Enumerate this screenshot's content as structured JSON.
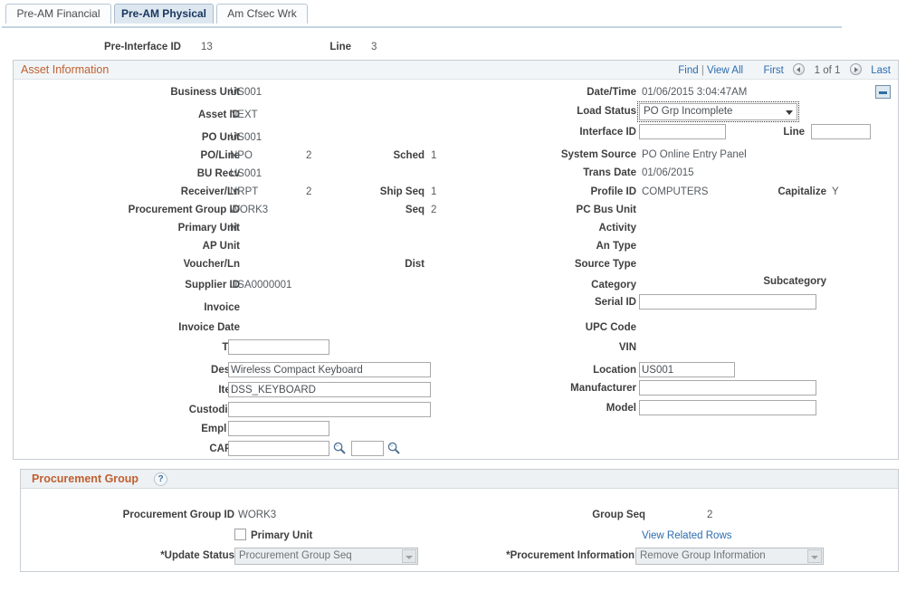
{
  "tabs": [
    {
      "label": "Pre-AM Financial",
      "active": false
    },
    {
      "label": "Pre-AM Physical",
      "active": true
    },
    {
      "label": "Am Cfsec Wrk",
      "active": false
    }
  ],
  "key_row": {
    "pre_interface_id_label": "Pre-Interface ID",
    "pre_interface_id_value": "13",
    "line_label": "Line",
    "line_value": "3"
  },
  "asset_information": {
    "title": "Asset Information",
    "nav": {
      "find": "Find",
      "separator": "|",
      "view_all": "View All",
      "first": "First",
      "counter": "1 of 1",
      "last": "Last"
    },
    "collapse_icon": "minus-icon",
    "left": {
      "business_unit_label": "Business Unit",
      "business_unit_value": "US001",
      "asset_id_label": "Asset ID",
      "asset_id_value": "NEXT",
      "po_unit_label": "PO Unit",
      "po_unit_value": "US001",
      "po_line_label": "PO/Line",
      "po_line_value": "NPO",
      "po_line_num": "2",
      "sched_label": "Sched",
      "sched_value": "1",
      "bu_recv_label": "BU Recv",
      "bu_recv_value": "US001",
      "receiver_ln_label": "Receiver/Ln",
      "receiver_ln_value": "NRPT",
      "receiver_ln_num": "2",
      "ship_seq_label": "Ship Seq",
      "ship_seq_value": "1",
      "procurement_group_id_label": "Procurement Group ID",
      "procurement_group_id_value": "WORK3",
      "seq_label": "Seq",
      "seq_value": "2",
      "primary_unit_label": "Primary Unit",
      "primary_unit_value": "N",
      "ap_unit_label": "AP Unit",
      "ap_unit_value": "",
      "voucher_ln_label": "Voucher/Ln",
      "voucher_ln_value": "",
      "dist_label": "Dist",
      "dist_value": "",
      "supplier_id_label": "Supplier ID",
      "supplier_id_value": "USA0000001",
      "invoice_label": "Invoice",
      "invoice_value": "",
      "invoice_date_label": "Invoice Date",
      "invoice_date_value": "",
      "tag_label": "Tag",
      "tag_value": "",
      "descr_label": "Descr",
      "descr_value": "Wireless Compact Keyboard",
      "item_label": "Item",
      "item_value": "DSS_KEYBOARD",
      "custodian_label": "Custodian",
      "custodian_value": "",
      "empl_id_label": "Empl ID",
      "empl_id_value": "",
      "cap_label": "CAP #",
      "cap_value": "",
      "cap_suffix_value": "",
      "cap_lookup_icon": "search-icon",
      "cap_suffix_lookup_icon": "search-icon"
    },
    "right": {
      "date_time_label": "Date/Time",
      "date_time_value": "01/06/2015 3:04:47AM",
      "load_status_label": "Load Status",
      "load_status_value": "PO Grp Incomplete",
      "load_status_options": [
        "PO Grp Incomplete"
      ],
      "interface_id_label": "Interface ID",
      "interface_id_value": "",
      "line_label": "Line",
      "line_value": "",
      "system_source_label": "System Source",
      "system_source_value": "PO Online Entry Panel",
      "trans_date_label": "Trans Date",
      "trans_date_value": "01/06/2015",
      "profile_id_label": "Profile ID",
      "profile_id_value": "COMPUTERS",
      "capitalize_label": "Capitalize",
      "capitalize_value": "Y",
      "pc_bus_unit_label": "PC Bus Unit",
      "pc_bus_unit_value": "",
      "activity_label": "Activity",
      "activity_value": "",
      "an_type_label": "An Type",
      "an_type_value": "",
      "source_type_label": "Source Type",
      "source_type_value": "",
      "category_label": "Category",
      "category_value": "",
      "subcategory_label": "Subcategory",
      "subcategory_value": "",
      "serial_id_label": "Serial ID",
      "serial_id_value": "",
      "upc_code_label": "UPC Code",
      "upc_code_value": "",
      "vin_label": "VIN",
      "vin_value": "",
      "location_label": "Location",
      "location_value": "US001",
      "manufacturer_label": "Manufacturer",
      "manufacturer_value": "",
      "model_label": "Model",
      "model_value": ""
    }
  },
  "procurement_group": {
    "title": "Procurement Group",
    "help_icon": "help-icon",
    "procurement_group_id_label": "Procurement Group ID",
    "procurement_group_id_value": "WORK3",
    "primary_unit_label": "Primary Unit",
    "primary_unit_checked": false,
    "update_status_label": "*Update Status",
    "update_status_value": "Procurement Group Seq",
    "group_seq_label": "Group Seq",
    "group_seq_value": "2",
    "view_related_rows_link": "View Related Rows",
    "procurement_information_label": "*Procurement Information",
    "procurement_information_value": "Remove Group Information"
  },
  "colors": {
    "section_header_text": "#bf6030",
    "link": "#2b6cb0",
    "label_text": "#3f3f3f",
    "value_text": "#555b60",
    "active_tab_bg": "#dde7f0",
    "section_header_bg": "#f2f5f7"
  }
}
